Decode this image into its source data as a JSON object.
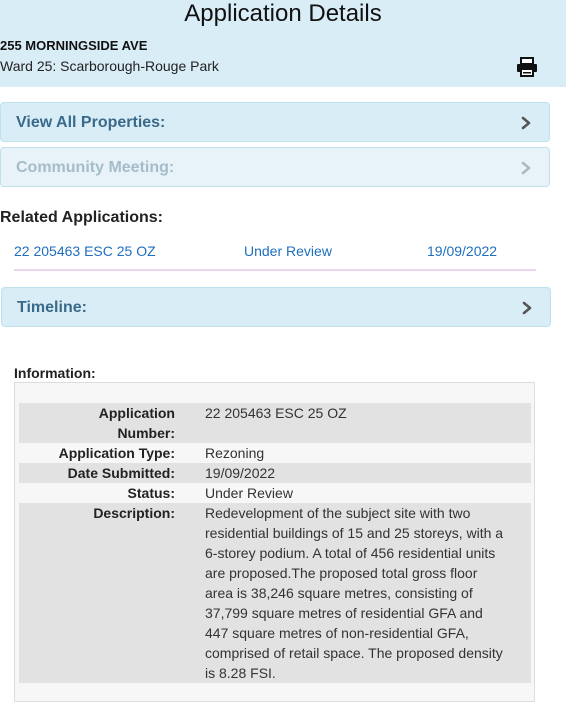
{
  "header": {
    "title": "Application Details",
    "address": "255 MORNINGSIDE AVE",
    "ward": "Ward 25: Scarborough-Rouge Park",
    "print_icon": "printer-icon"
  },
  "panels": {
    "view_all": "View All Properties:",
    "community": "Community Meeting:",
    "timeline": "Timeline:",
    "chevron_icon": "chevron-right-icon"
  },
  "related": {
    "heading": "Related Applications:",
    "rows": [
      {
        "number": "22 205463 ESC 25 OZ",
        "status": "Under Review",
        "date": "19/09/2022"
      }
    ]
  },
  "information": {
    "heading": "Information:",
    "application_number_label": "Application Number:",
    "application_number": "22 205463 ESC 25 OZ",
    "application_type_label": "Application Type:",
    "application_type": "Rezoning",
    "date_submitted_label": "Date Submitted:",
    "date_submitted": "19/09/2022",
    "status_label": "Status:",
    "status": "Under Review",
    "description_label": "Description:",
    "description": "Redevelopment of the subject site with two residential buildings of 15 and 25 storeys, with a 6-storey podium. A total of 456 residential units are proposed.The proposed total gross floor area is 38,246 square metres, consisting of 37,799 square metres of residential GFA and 447 square metres of non-residential GFA, comprised of retail space. The proposed density is 8.28 FSI."
  },
  "colors": {
    "header_bg": "#d9edf7",
    "link": "#1f6fbf",
    "panel_text": "#3a6a8a",
    "panel_disabled_text": "#a5bcc9"
  }
}
